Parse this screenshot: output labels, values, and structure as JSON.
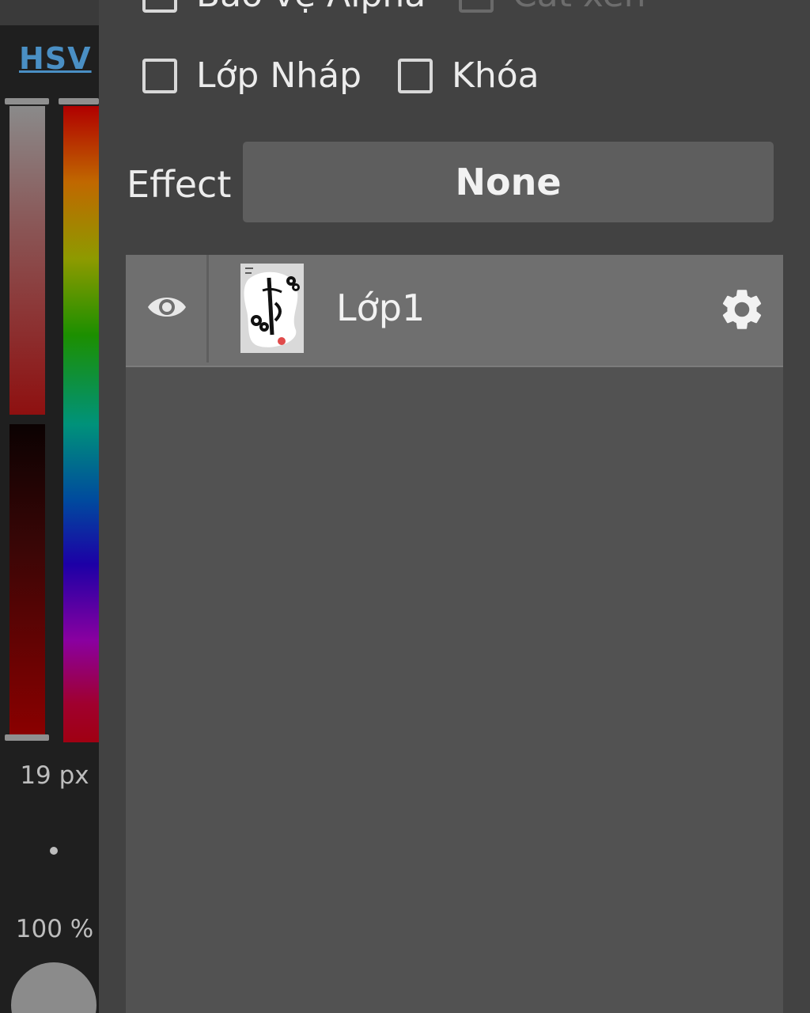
{
  "color_panel": {
    "mode_label": "HSV",
    "brush_size": "19 px",
    "opacity": "100 %",
    "current_color": "#8b8b8b",
    "hue_color": "#a00000"
  },
  "layer_options": {
    "checkboxes": [
      {
        "label": "Bảo vệ Alpha",
        "checked": false,
        "enabled": true
      },
      {
        "label": "Cắt xén",
        "checked": false,
        "enabled": false
      },
      {
        "label": "Lớp Nháp",
        "checked": false,
        "enabled": true
      },
      {
        "label": "Khóa",
        "checked": false,
        "enabled": true
      }
    ],
    "effect_label": "Effect",
    "effect_value": "None"
  },
  "layers": [
    {
      "name": "Lớp1",
      "visible": true,
      "visibility_icon": "eye-icon",
      "settings_icon": "gear-icon"
    }
  ]
}
